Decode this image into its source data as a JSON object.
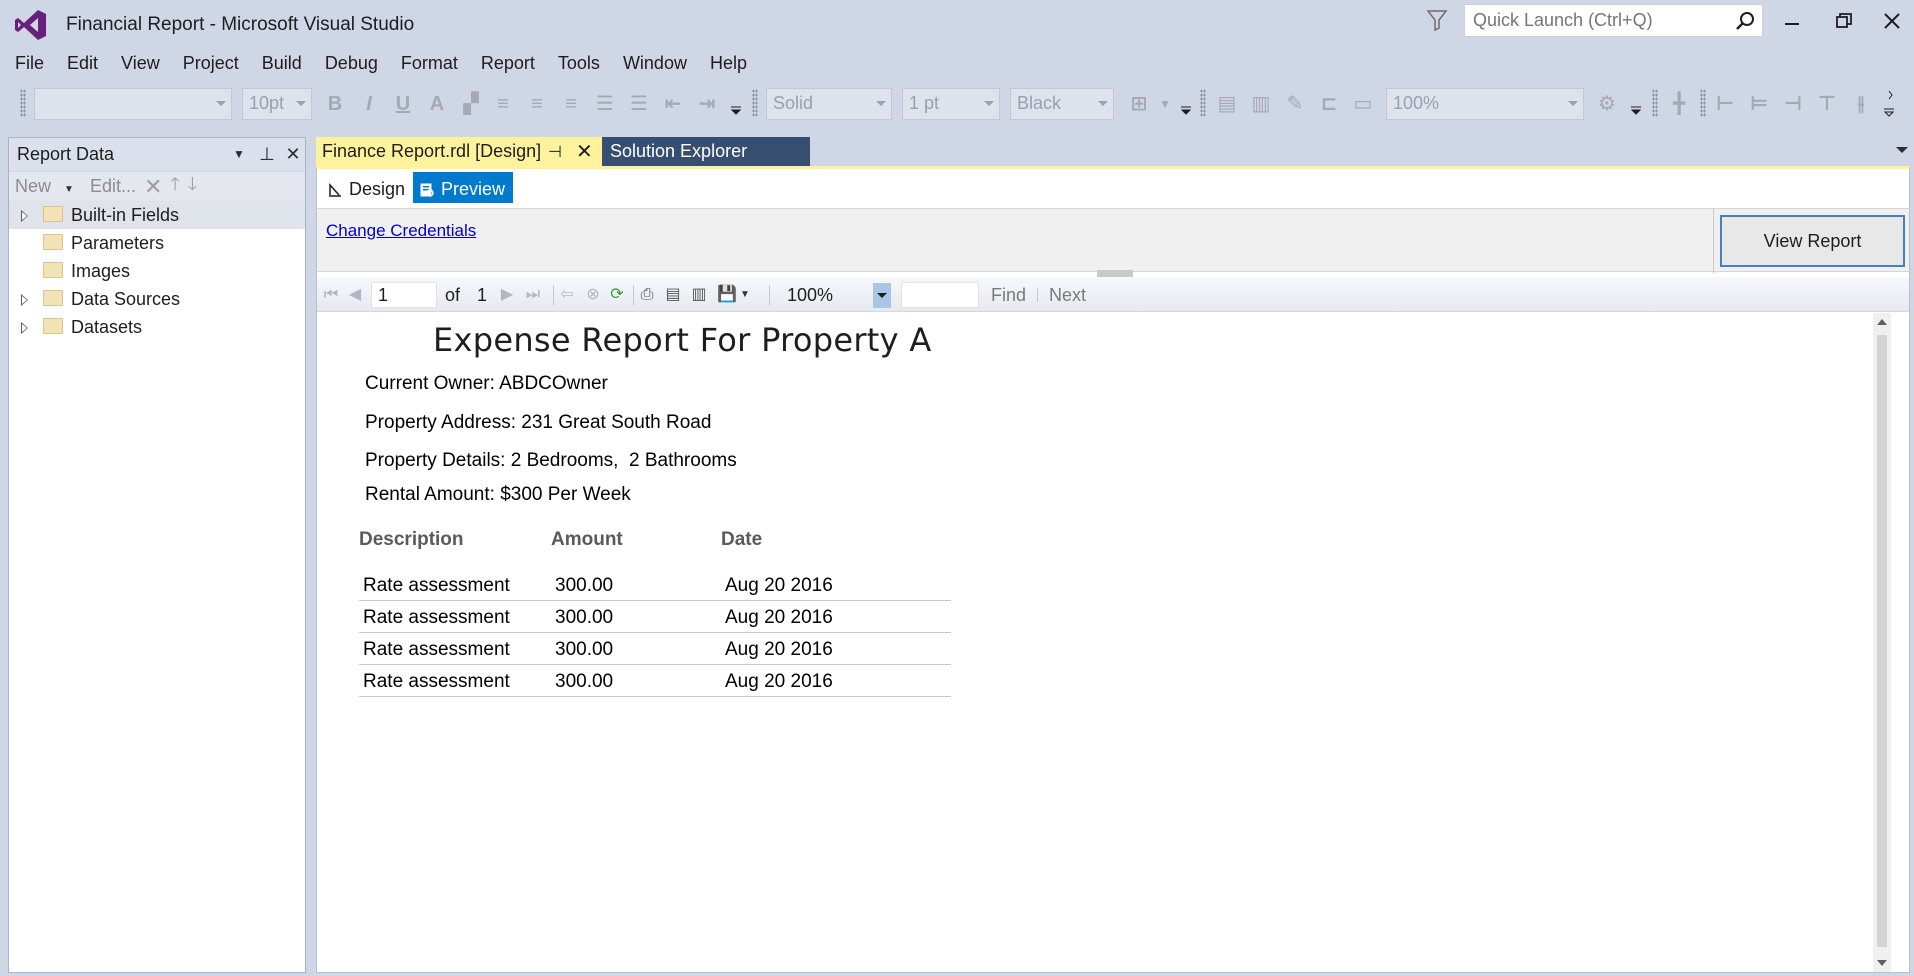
{
  "window": {
    "title": "Financial Report - Microsoft Visual Studio",
    "quick_launch_placeholder": "Quick Launch (Ctrl+Q)"
  },
  "menu": [
    "File",
    "Edit",
    "View",
    "Project",
    "Build",
    "Debug",
    "Format",
    "Report",
    "Tools",
    "Window",
    "Help"
  ],
  "toolbar": {
    "font_name": "",
    "font_size": "10pt",
    "border_style": "Solid",
    "border_width": "1 pt",
    "border_color": "Black",
    "zoom": "100%"
  },
  "report_data_panel": {
    "title": "Report Data",
    "tools": {
      "new": "New",
      "edit": "Edit..."
    },
    "items": [
      {
        "label": "Built-in Fields",
        "expandable": true,
        "selected": true
      },
      {
        "label": "Parameters",
        "expandable": false
      },
      {
        "label": "Images",
        "expandable": false
      },
      {
        "label": "Data Sources",
        "expandable": true
      },
      {
        "label": "Datasets",
        "expandable": true
      }
    ]
  },
  "tabs": {
    "active": "Finance Report.rdl [Design]",
    "second": "Solution Explorer"
  },
  "subtabs": {
    "design": "Design",
    "preview": "Preview"
  },
  "params": {
    "change_credentials": "Change Credentials",
    "view_report": "View Report"
  },
  "report_toolbar": {
    "page": "1",
    "of_label": "of",
    "total_pages": "1",
    "zoom": "100%",
    "find": "Find",
    "next": "Next"
  },
  "report": {
    "title": "Expense Report For Property A",
    "owner": "Current Owner: ABDCOwner",
    "address": "Property Address: 231 Great South Road",
    "details": "Property Details: 2 Bedrooms,  2 Bathrooms",
    "rental": "Rental Amount: $300 Per Week",
    "columns": [
      "Description",
      "Amount",
      "Date"
    ],
    "rows": [
      [
        "Rate assessment",
        "300.00",
        "Aug 20 2016"
      ],
      [
        "Rate assessment",
        "300.00",
        "Aug 20 2016"
      ],
      [
        "Rate assessment",
        "300.00",
        "Aug 20 2016"
      ],
      [
        "Rate assessment",
        "300.00",
        "Aug 20 2016"
      ]
    ]
  },
  "colors": {
    "accent": "#007acc",
    "active_tab": "#fff29d",
    "chrome": "#cfd6e5",
    "inactive_tab": "#364e6f",
    "brand": "#68217a"
  }
}
